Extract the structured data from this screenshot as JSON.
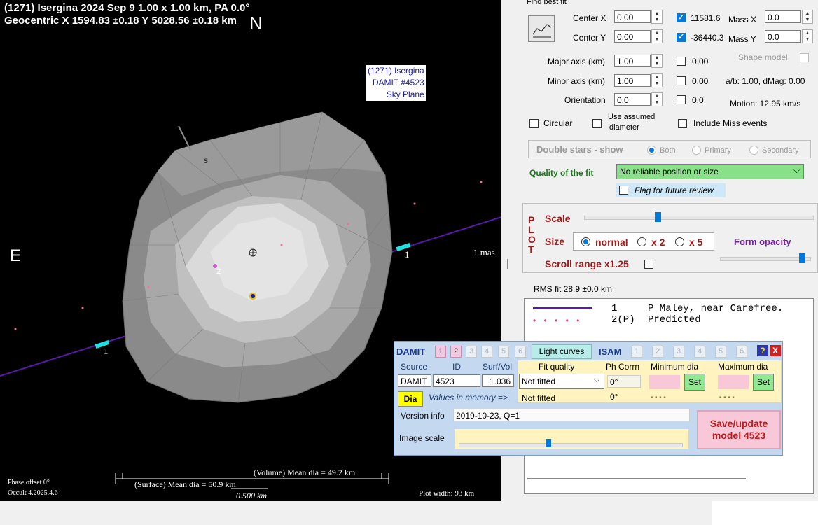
{
  "plot": {
    "title_line1": "(1271) Isergina  2024 Sep 9   1.00 x 1.00 km, PA 0.0°",
    "title_line2": "Geocentric  X  1594.83 ±0.18  Y 5028.56 ±0.18 km",
    "north": "N",
    "east": "E",
    "south_mark": "s",
    "label_box": [
      "(1271) Isergina",
      "DAMIT #4523",
      "Sky Plane"
    ],
    "scale_mas": "1 mas",
    "chord_label_1": "1",
    "chord_label_1b": "1",
    "predicted_label": "2",
    "volume_dia": "(Volume) Mean dia = 49.2 km",
    "surface_dia": "(Surface) Mean dia = 50.9 km",
    "scale_km": "0.500 km",
    "phase_offset": "Phase offset 0°",
    "version": "Occult 4.2025.4.6",
    "plot_width": "Plot width: 93 km"
  },
  "fit": {
    "group_title": "Find best fit",
    "center_x_label": "Center X",
    "center_x": "0.00",
    "center_y_label": "Center Y",
    "center_y": "0.00",
    "x_check_value": "11581.6",
    "y_check_value": "-36440.3",
    "mass_x_label": "Mass X",
    "mass_x": "0.0",
    "mass_y_label": "Mass Y",
    "mass_y": "0.0",
    "major_label": "Major axis (km)",
    "major": "1.00",
    "major_check": "0.00",
    "minor_label": "Minor axis (km)",
    "minor": "1.00",
    "minor_check": "0.00",
    "orient_label": "Orientation",
    "orient": "0.0",
    "orient_check": "0.0",
    "shape_model": "Shape model",
    "ab_text": "a/b: 1.00, dMag: 0.00",
    "motion": "Motion: 12.95 km/s",
    "circular": "Circular",
    "assumed_1": "Use assumed",
    "assumed_2": "diameter",
    "include_miss": "Include Miss events",
    "double_stars": "Double stars - show",
    "both": "Both",
    "primary": "Primary",
    "secondary": "Secondary",
    "quality_label": "Quality of the fit",
    "quality_value": "No reliable position or size",
    "flag_label": "Flag for future review"
  },
  "plotctl": {
    "plot_letters": [
      "P",
      "L",
      "O",
      "T"
    ],
    "scale": "Scale",
    "scale_level": 0.32,
    "size": "Size",
    "normal": "normal",
    "x2": "x 2",
    "x5": "x 5",
    "form_opacity": "Form opacity",
    "opacity_level": 0.95,
    "scroll": "Scroll range x1.25"
  },
  "rms": "RMS fit 28.9 ±0.0 km",
  "legend": [
    {
      "num": "1",
      "name": "P Maley, near Carefree."
    },
    {
      "num": "2(P)",
      "name": "Predicted"
    }
  ],
  "damit": {
    "title": "DAMIT",
    "nums": [
      "1",
      "2",
      "3",
      "4",
      "5",
      "6"
    ],
    "light_curves": "Light curves",
    "isam": "ISAM",
    "isam_nums": [
      "1",
      "2",
      "3",
      "4",
      "5",
      "6"
    ],
    "help": "?",
    "close": "X",
    "source_h": "Source",
    "id_h": "ID",
    "surf_h": "Surf/Vol",
    "fitq_h": "Fit quality",
    "phcorr_h": "Ph Corrn",
    "mindia_h": "Minimum dia",
    "maxdia_h": "Maximum dia",
    "source": "DAMIT",
    "id": "4523",
    "surf": "1.036",
    "fitq": "Not fitted",
    "phcorr": "0°",
    "set": "Set",
    "dia": "Dia",
    "mem_label": "Values in memory =>",
    "mem_fitq": "Not fitted",
    "mem_ph": "0°",
    "mem_min": "- - - -",
    "mem_max": "- - - -",
    "version_label": "Version info",
    "version_value": "2019-10-23, Q=1",
    "image_scale": "Image scale",
    "image_scale_level": 0.4,
    "save_1": "Save/update",
    "save_2": "model 4523"
  }
}
